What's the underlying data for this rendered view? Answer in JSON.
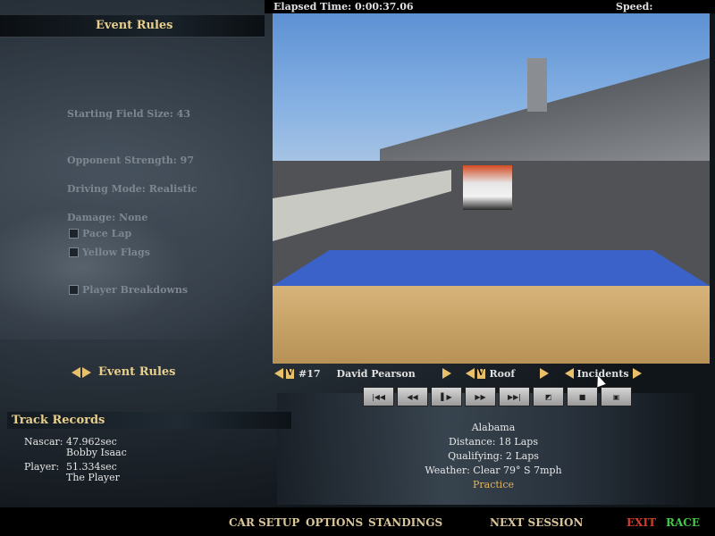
{
  "left_panel": {
    "title": "Event Rules",
    "rules": {
      "starting_field_size": "Starting Field Size: 43",
      "opponent_strength": "Opponent Strength: 97",
      "driving_mode": "Driving Mode: Realistic",
      "damage": "Damage: None"
    },
    "checkboxes": {
      "pace_lap": "Pace Lap",
      "yellow_flags": "Yellow Flags",
      "player_breakdowns": "Player Breakdowns"
    },
    "nav_label": "Event Rules"
  },
  "track_records": {
    "title": "Track Records",
    "nascar_label": "Nascar:",
    "nascar_time": "47.962sec",
    "nascar_holder": "Bobby Isaac",
    "player_label": "Player:",
    "player_time": "51.334sec",
    "player_holder": "The Player"
  },
  "hud": {
    "elapsed": "Elapsed Time: 0:00:37.06",
    "speed": "Speed:"
  },
  "view_nav": {
    "car_number": "#17",
    "driver": "David Pearson",
    "camera": "Roof",
    "mode": "Incidents"
  },
  "session_info": {
    "track": "Alabama",
    "distance": "Distance: 18 Laps",
    "qualifying": "Qualifying: 2 Laps",
    "weather": "Weather: Clear 79° S 7mph",
    "session": "Practice"
  },
  "bottom_menu": {
    "car_setup": "CAR SETUP",
    "options": "OPTIONS",
    "standings": "STANDINGS",
    "next_session": "NEXT SESSION",
    "exit": "EXIT",
    "race": "RACE"
  },
  "colors": {
    "accent_gold": "#e8cf8c",
    "exit_red": "#d33b2c",
    "race_green": "#43c64a"
  }
}
